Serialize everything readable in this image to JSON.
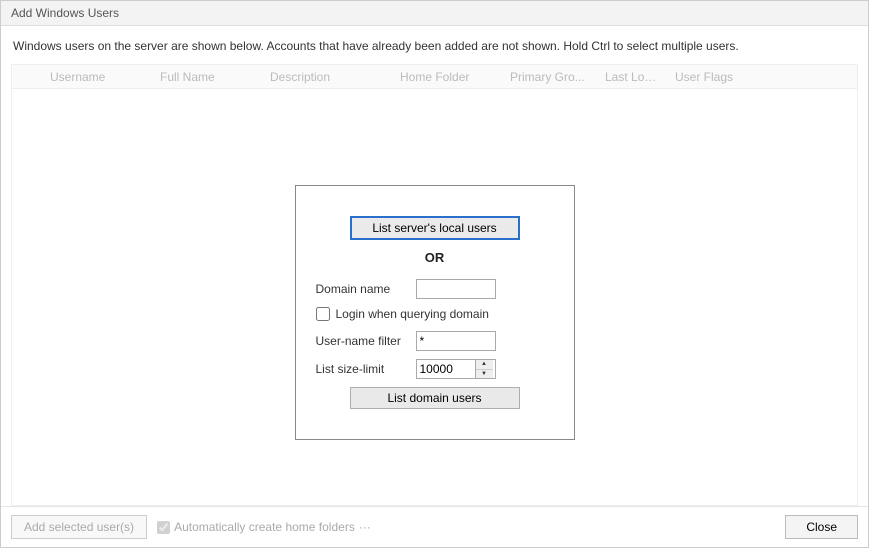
{
  "window": {
    "title": "Add Windows Users"
  },
  "instructions": "Windows users on the server are shown below.  Accounts that have already been added are not shown.  Hold Ctrl to select multiple users.",
  "table": {
    "headers": {
      "username": "Username",
      "fullname": "Full Name",
      "description": "Description",
      "homefolder": "Home Folder",
      "primarygroup": "Primary Gro...",
      "lastlogin": "Last Login",
      "userflags": "User Flags"
    }
  },
  "panel": {
    "list_local_label": "List server's local users",
    "or_label": "OR",
    "domain_name_label": "Domain name",
    "domain_name_value": "",
    "login_when_querying_label": "Login when querying domain",
    "login_when_querying_checked": false,
    "username_filter_label": "User-name filter",
    "username_filter_value": "*",
    "list_size_limit_label": "List size-limit",
    "list_size_limit_value": "10000",
    "list_domain_label": "List domain users"
  },
  "footer": {
    "add_selected_label": "Add selected user(s)",
    "auto_create_label": "Automatically create home folders",
    "auto_create_checked": true,
    "dots": "···",
    "close_label": "Close"
  }
}
